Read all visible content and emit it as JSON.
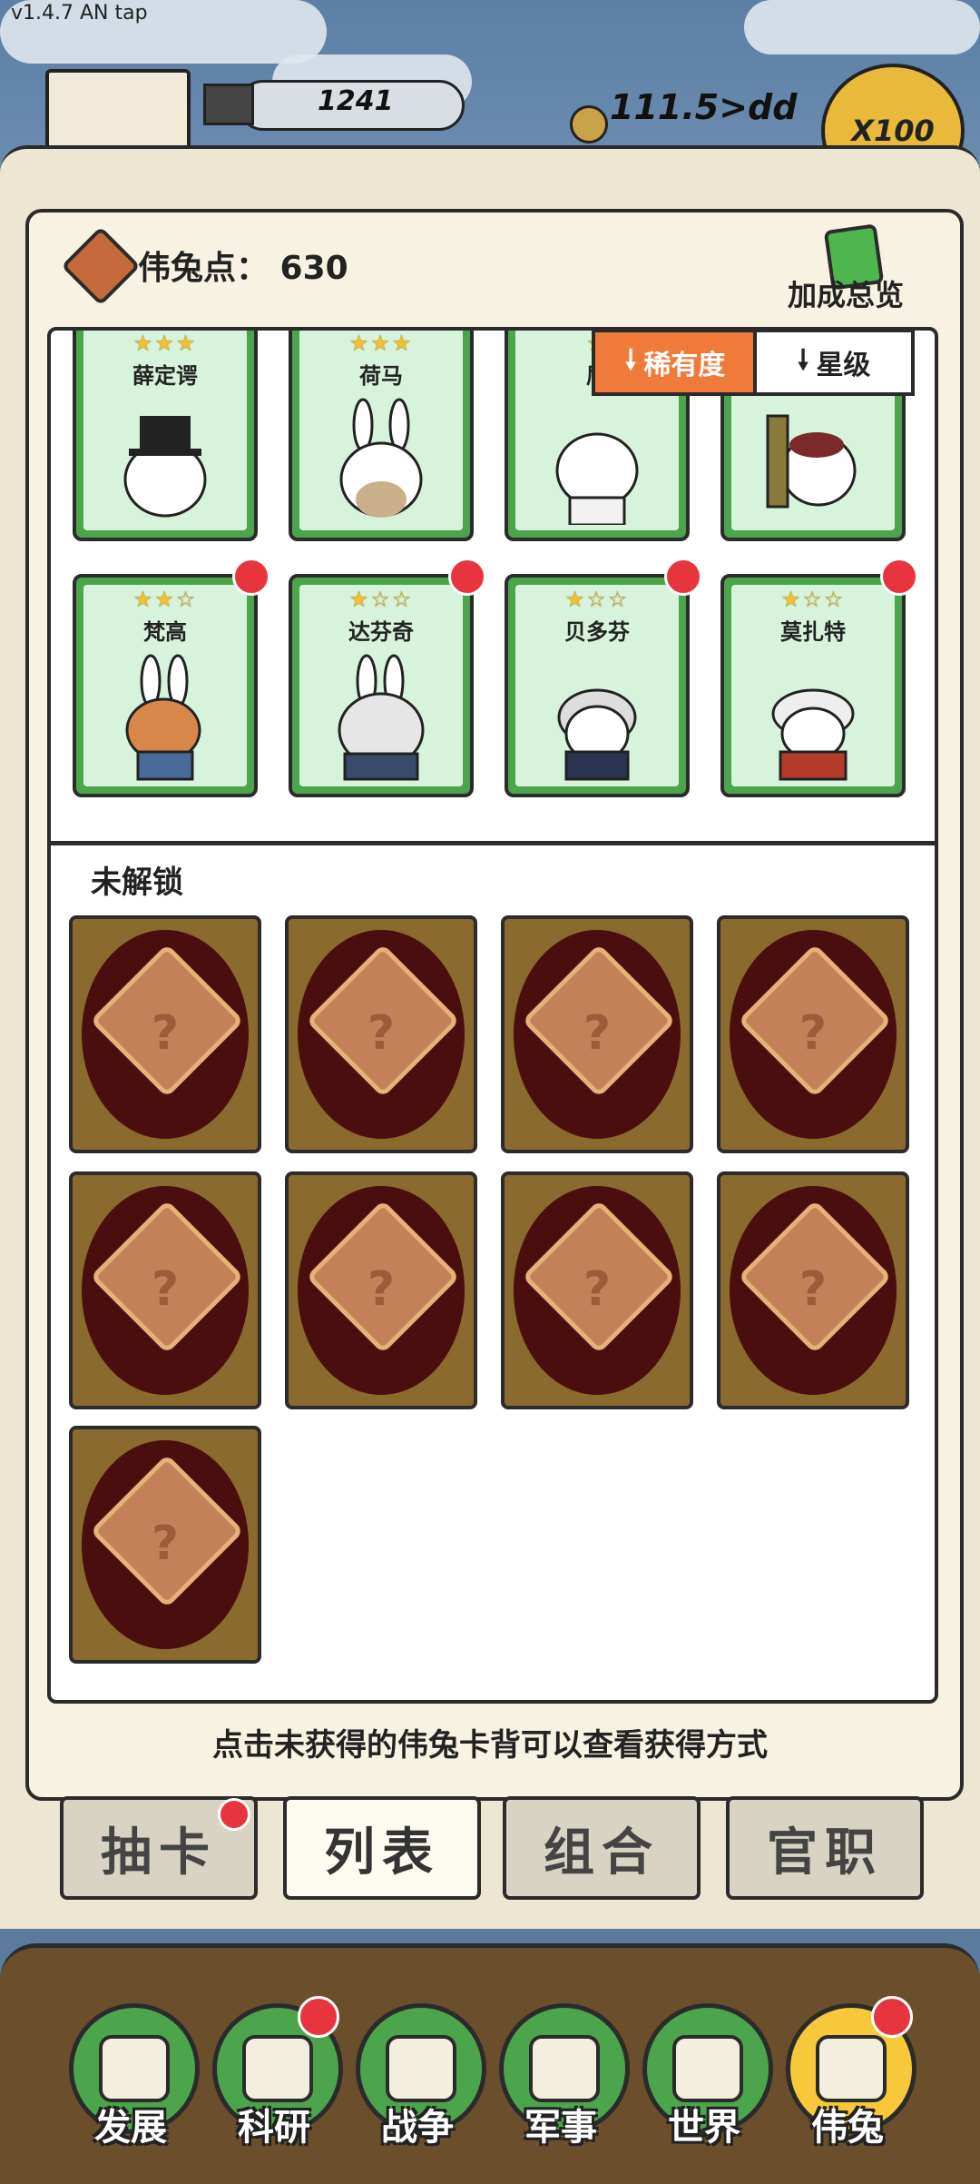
{
  "app": {
    "version": "v1.4.7 AN tap"
  },
  "top_bar": {
    "resource_1": "1241",
    "resource_2": "111.5>dd",
    "multiplier": "X100"
  },
  "header": {
    "points_label": "伟兔点： 630",
    "bonus_label": "加成总览"
  },
  "sort": {
    "rarity": "稀有度",
    "star": "星级"
  },
  "owned_cards": [
    {
      "name": "薛定谔",
      "stars": "★★★"
    },
    {
      "name": "荷马",
      "stars": "★★★"
    },
    {
      "name": "屈",
      "stars": "★"
    },
    {
      "name": "",
      "stars": ""
    },
    {
      "name": "梵高",
      "stars": "★★☆"
    },
    {
      "name": "达芬奇",
      "stars": "★☆☆"
    },
    {
      "name": "贝多芬",
      "stars": "★☆☆"
    },
    {
      "name": "莫扎特",
      "stars": "★☆☆"
    }
  ],
  "locked": {
    "label": "未解锁",
    "count": 9,
    "mark": "?"
  },
  "hint": "点击未获得的伟兔卡背可以查看获得方式",
  "tabs": [
    "抽卡",
    "列表",
    "组合",
    "官职"
  ],
  "nav": [
    "发展",
    "科研",
    "战争",
    "军事",
    "世界",
    "伟兔"
  ],
  "colors": {
    "accent": "#f07a3a",
    "card_green": "#4ca54c",
    "badge_red": "#e8343f"
  }
}
